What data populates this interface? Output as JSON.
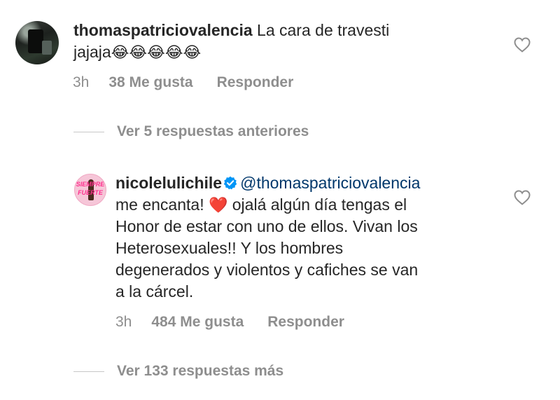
{
  "comments": [
    {
      "username": "thomaspatriciovalencia",
      "text_line1": " La cara de travesti",
      "text_line2": "jajaja",
      "emojis": "😂😂😂😂😂",
      "time": "3h",
      "likes": "38 Me gusta",
      "reply": "Responder",
      "avatar_icon": "profile-photo-dark-landscape"
    },
    {
      "username": "nicolelulichile",
      "verified": true,
      "mention": "@thomaspatriciovalencia",
      "text_line1": "me encanta! ",
      "heart_emoji": "❤️",
      "text_line1b": " ojalá algún día tengas el",
      "text_line2": "Honor de estar con uno de ellos. Vivan los",
      "text_line3": "Heterosexuales!! Y los hombres",
      "text_line4": "degenerados y violentos y cafiches se van",
      "text_line5": "a la cárcel.",
      "time": "3h",
      "likes": "484 Me gusta",
      "reply": "Responder",
      "avatar_text1": "SIEMPRE",
      "avatar_text2": "FUERTE"
    }
  ],
  "view_previous": "Ver 5 respuestas anteriores",
  "view_more": "Ver 133 respuestas más",
  "colors": {
    "text": "#262626",
    "meta": "#8e8e8e",
    "mention": "#00376b",
    "verified": "#0095f6"
  }
}
